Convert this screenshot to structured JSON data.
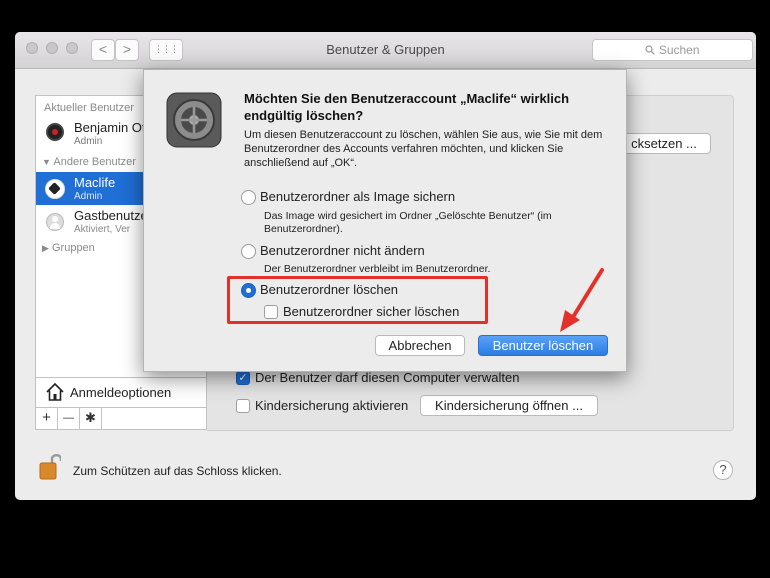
{
  "window": {
    "title": "Benutzer & Gruppen",
    "search_placeholder": "Suchen",
    "nav_back": "<",
    "nav_forward": ">",
    "grid": "⋮⋮⋮"
  },
  "sidebar": {
    "current_header": "Aktueller Benutzer",
    "current_user": {
      "name": "Benjamin Ot",
      "role": "Admin"
    },
    "other_header": "Andere Benutzer",
    "users": [
      {
        "name": "Maclife",
        "role": "Admin",
        "selected": true
      },
      {
        "name": "Gastbenutze",
        "role": "Aktiviert, Ver"
      }
    ],
    "groups_label": "Gruppen",
    "login_options": "Anmeldeoptionen",
    "add": "+",
    "remove": "—",
    "gear": "✱"
  },
  "panel": {
    "reset_button": "cksetzen ...",
    "admin_checkbox": {
      "label": "Der Benutzer darf diesen Computer verwalten",
      "checked": true
    },
    "parental_checkbox": {
      "label": "Kindersicherung aktivieren",
      "checked": false
    },
    "parental_button": "Kindersicherung öffnen ..."
  },
  "footer": {
    "lock_text": "Zum Schützen auf das Schloss klicken.",
    "help": "?"
  },
  "dialog": {
    "title": "Möchten Sie den Benutzeraccount „Maclife“ wirklich endgültig löschen?",
    "description": "Um diesen Benutzeraccount zu löschen, wählen Sie aus, wie Sie mit dem Benutzerordner des Accounts verfahren möchten, und klicken Sie anschließend auf „OK“.",
    "options": [
      {
        "label": "Benutzerordner als Image sichern",
        "note": "Das Image wird gesichert im Ordner „Gelöschte Benutzer“ (im Benutzerordner).",
        "selected": false
      },
      {
        "label": "Benutzerordner nicht ändern",
        "note": "Der Benutzerordner verbleibt im Benutzerordner.",
        "selected": false
      },
      {
        "label": "Benutzerordner löschen",
        "note": "",
        "selected": true
      }
    ],
    "secure_delete": {
      "label": "Benutzerordner sicher löschen",
      "checked": false
    },
    "cancel": "Abbrechen",
    "confirm": "Benutzer löschen"
  },
  "colors": {
    "accent": "#1f6fd6",
    "highlight": "#e3312a"
  }
}
